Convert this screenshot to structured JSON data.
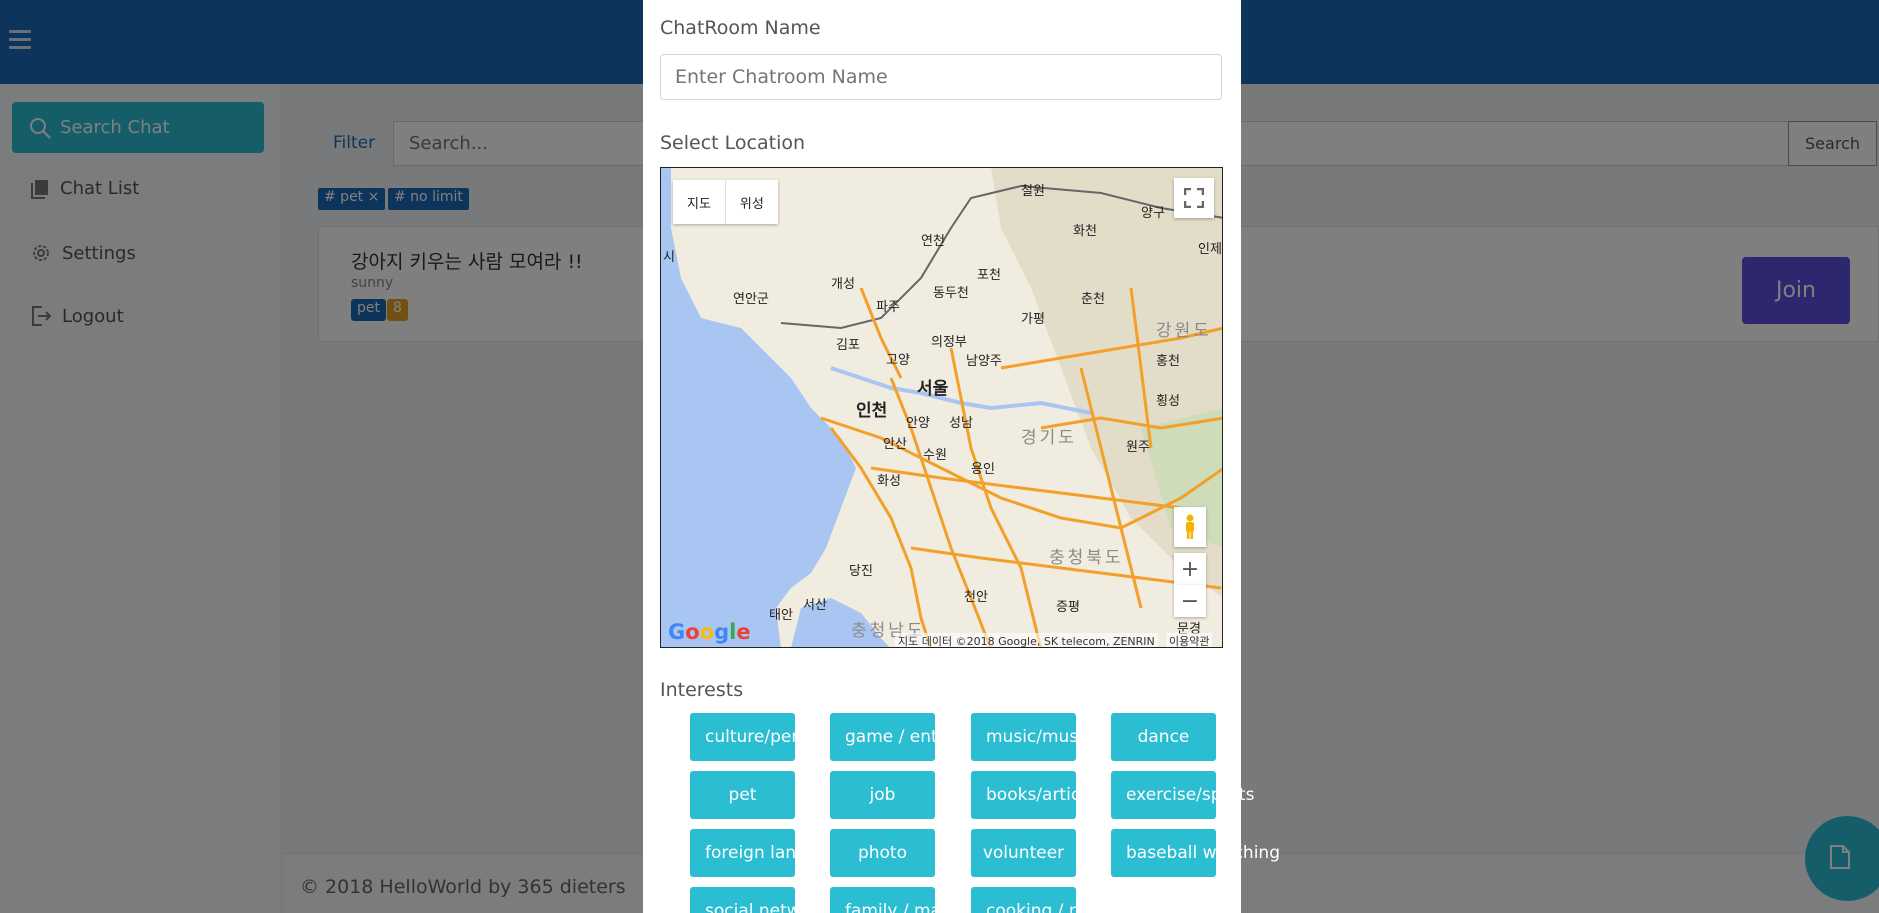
{
  "sidebar": {
    "search_chat": "Search Chat",
    "items": [
      {
        "label": "Chat List",
        "icon": "book-icon"
      },
      {
        "label": "Settings",
        "icon": "gear-icon"
      },
      {
        "label": "Logout",
        "icon": "logout-icon"
      }
    ]
  },
  "main": {
    "filter_label": "Filter",
    "search_placeholder": "Search...",
    "search_button": "Search",
    "tags": [
      "# pet ×",
      "# no limit"
    ],
    "room": {
      "title": "강아지 키우는 사람 모여라 !!",
      "owner": "sunny",
      "tag": "pet",
      "count": "8",
      "join_label": "Join"
    },
    "footer": "© 2018 HelloWorld by 365 dieters"
  },
  "modal": {
    "name_label": "ChatRoom Name",
    "name_placeholder": "Enter Chatroom Name",
    "location_label": "Select Location",
    "map": {
      "type_map": "지도",
      "type_satellite": "위성",
      "copyright": "지도 데이터 ©2018 Google, SK telecom, ZENRIN",
      "terms": "이용약관",
      "logo": "Google",
      "zoom_in": "+",
      "zoom_out": "−",
      "cities": [
        "철원",
        "화천",
        "양구",
        "인제",
        "연천",
        "포천",
        "춘천",
        "개성",
        "동두천",
        "파주",
        "연안군",
        "가평",
        "강원도",
        "김포",
        "의정부",
        "고양",
        "남양주",
        "홍천",
        "서울",
        "인천",
        "횡성",
        "안양",
        "성남",
        "경기도",
        "안산",
        "수원",
        "원주",
        "용인",
        "화성",
        "충청북도",
        "당진",
        "천안",
        "서산",
        "증평",
        "태안",
        "충청남도",
        "문경",
        "시"
      ]
    },
    "interests_label": "Interests",
    "interests": [
      "culture/performance",
      "game / entertainment",
      "music/musical",
      "dance",
      "pet",
      "job",
      "books/articles",
      "exercise/sports",
      "foreign language",
      "photo",
      "volunteer",
      "baseball watching",
      "social network",
      "family / marriage",
      "cooking / recipe"
    ]
  },
  "colors": {
    "topbar": "#1a6ab8",
    "accent": "#2bbdd2",
    "join": "#5b4fe0",
    "badge_count": "#e8a020"
  }
}
